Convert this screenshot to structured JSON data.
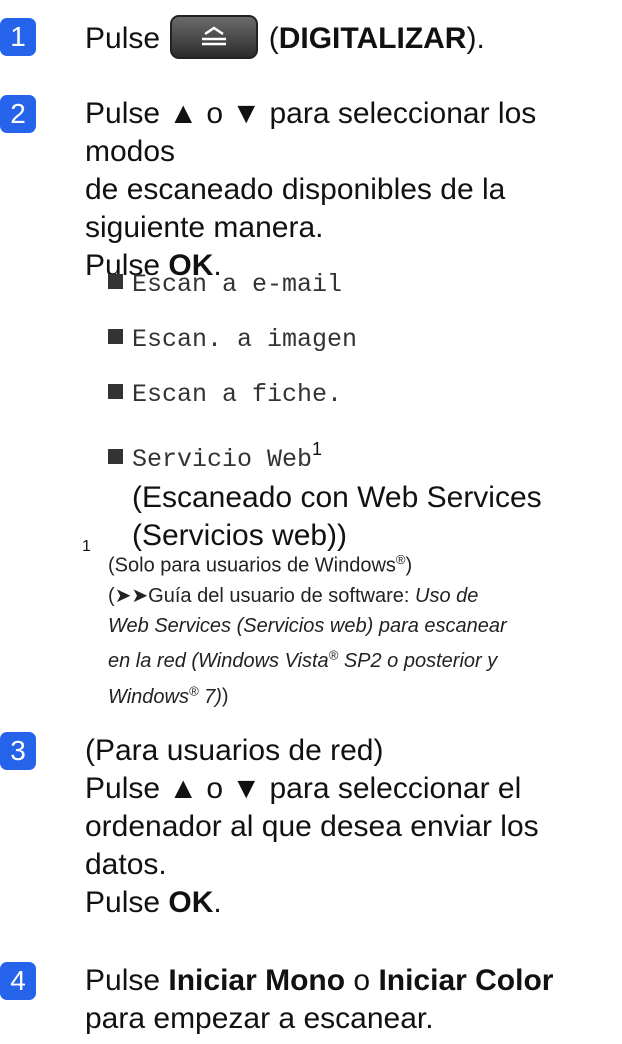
{
  "steps": [
    {
      "number": "1",
      "before": "Pulse ",
      "button_text": "DIGITALIZAR",
      "after": ")."
    },
    {
      "number": "2",
      "line1": "Pulse ▲ o ▼ para seleccionar los modos",
      "line2": "de escaneado disponibles de la",
      "line3": "siguiente manera.",
      "pulse": "Pulse ",
      "ok": "OK",
      "dot": "."
    },
    {
      "number": "3",
      "line1": "(Para usuarios de red)",
      "line2": "Pulse ▲ o ▼ para seleccionar el",
      "line3": "ordenador al que desea enviar los",
      "line4": "datos.",
      "pulse": "Pulse ",
      "ok": "OK",
      "dot": "."
    },
    {
      "number": "4",
      "pulse": "Pulse ",
      "mono_key": "Iniciar Mono",
      "or": " o ",
      "color_key": "Iniciar Color",
      "line2": "para empezar a escanear."
    }
  ],
  "options": [
    "Escan a e-mail",
    "Escan. a imagen",
    "Escan a fiche.",
    "Servicio Web"
  ],
  "option_sup": "1",
  "option_desc_1": "(Escaneado con Web Services",
  "option_desc_2": "(Servicios web))",
  "footnote": {
    "number": "1",
    "line1_a": "(Solo para usuarios de Windows",
    "line1_b": ")",
    "reg": "®",
    "line2_a": "(➤➤Guía del usuario de software: ",
    "line2_b": "Uso de",
    "line3": "Web Services (Servicios web) para escanear",
    "line4_a": "en la red (Windows Vista",
    "line4_b": " SP2 o posterior y",
    "line5_a": "Windows",
    "line5_b": " 7)",
    "line5_c": ")"
  },
  "icons": {
    "scan_button": "scan-tray-icon"
  },
  "colors": {
    "step_badge": "#2563eb"
  }
}
